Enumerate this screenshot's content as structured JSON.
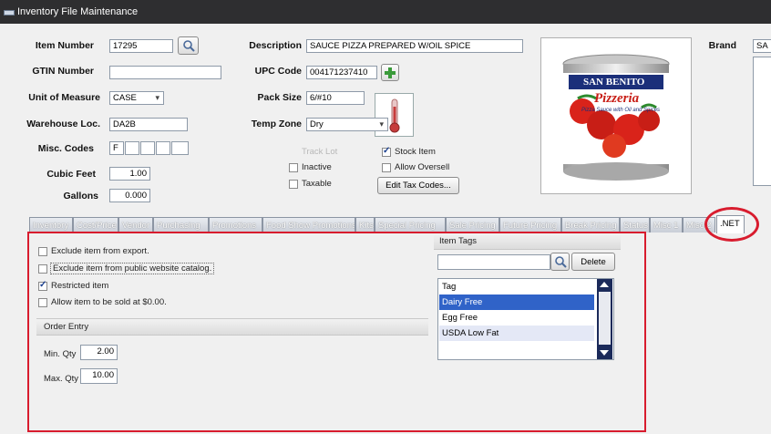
{
  "window": {
    "title": "Inventory File Maintenance"
  },
  "fields": {
    "item_number": {
      "label": "Item Number",
      "value": "17295"
    },
    "gtin_number": {
      "label": "GTIN Number",
      "value": ""
    },
    "unit_of_measure": {
      "label": "Unit of Measure",
      "value": "CASE"
    },
    "warehouse_loc": {
      "label": "Warehouse Loc.",
      "value": "DA2B"
    },
    "misc_codes": {
      "label": "Misc. Codes",
      "values": [
        "F",
        "",
        "",
        "",
        ""
      ]
    },
    "cubic_feet": {
      "label": "Cubic Feet",
      "value": "1.00"
    },
    "gallons": {
      "label": "Gallons",
      "value": "0.000"
    },
    "description": {
      "label": "Description",
      "value": "SAUCE PIZZA PREPARED W/OIL SPICE"
    },
    "upc_code": {
      "label": "UPC Code",
      "value": "004171237410"
    },
    "pack_size": {
      "label": "Pack Size",
      "value": "6/#10"
    },
    "temp_zone": {
      "label": "Temp Zone",
      "value": "Dry"
    },
    "brand": {
      "label": "Brand",
      "value": "SA"
    }
  },
  "checks": {
    "track_lot": "Track Lot",
    "stock_item": {
      "label": "Stock Item",
      "checked": true
    },
    "inactive": {
      "label": "Inactive",
      "checked": false
    },
    "allow_oversell": {
      "label": "Allow Oversell",
      "checked": false
    },
    "taxable": {
      "label": "Taxable",
      "checked": false
    }
  },
  "buttons": {
    "edit_tax_codes": "Edit Tax Codes..."
  },
  "product_image": {
    "brand": "SAN BENITO",
    "name": "Pizzeria",
    "tagline": "Pizza Sauce with Oil and Spices"
  },
  "tabs": [
    "Inventory",
    "Cost/Price",
    "Vendor",
    "Purchasing",
    "Promotions",
    "Food Show Promotions",
    "Kits",
    "Special Pricing",
    "Sale Pricing",
    "Future Pricing",
    "Break Pricing",
    "Status",
    "Misc 1",
    "Misc 2",
    ".NET"
  ],
  "active_tab": ".NET",
  "net_tab": {
    "options": [
      {
        "label": "Exclude item from export.",
        "checked": false
      },
      {
        "label": "Exclude item from public website catalog.",
        "checked": false
      },
      {
        "label": "Restricted item",
        "checked": true
      },
      {
        "label": "Allow item to be sold at $0.00.",
        "checked": false
      }
    ],
    "order_entry": {
      "header": "Order Entry",
      "min_qty": {
        "label": "Min. Qty",
        "value": "2.00"
      },
      "max_qty": {
        "label": "Max. Qty",
        "value": "10.00"
      }
    },
    "item_tags": {
      "header": "Item Tags",
      "search_value": "",
      "delete_label": "Delete",
      "column_header": "Tag",
      "tags": [
        "Dairy Free",
        "Egg Free",
        "USDA Low Fat"
      ],
      "selected": "Dairy Free"
    }
  },
  "colors": {
    "highlight": "#d81c2e",
    "selection": "#3063c8",
    "titlebar": "#2e2e30"
  }
}
